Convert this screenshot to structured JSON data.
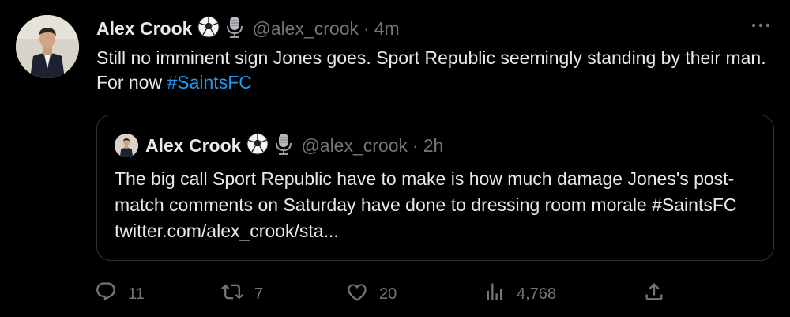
{
  "tweet": {
    "author_name": "Alex Crook",
    "handle": "@alex_crook",
    "separator": "·",
    "time": "4m",
    "text_main": "Still no imminent sign Jones goes. Sport Republic seemingly standing by their man. For now ",
    "hashtag": "#SaintsFC"
  },
  "quote": {
    "author_name": "Alex Crook",
    "handle": "@alex_crook",
    "separator": "·",
    "time": "2h",
    "text": "The big call Sport Republic have to make is how much damage Jones's post-match comments on Saturday have done to dressing room morale #SaintsFC twitter.com/alex_crook/sta..."
  },
  "actions": {
    "replies": "11",
    "retweets": "7",
    "likes": "20",
    "views": "4,768"
  },
  "icons": [
    "soccer-ball-icon",
    "microphone-icon",
    "more-icon",
    "reply-icon",
    "retweet-icon",
    "like-icon",
    "views-icon",
    "share-icon"
  ],
  "colors": {
    "background": "#000000",
    "text": "#e7e9ea",
    "muted": "#71767b",
    "link": "#1d9bf0",
    "border": "#2f3336"
  }
}
